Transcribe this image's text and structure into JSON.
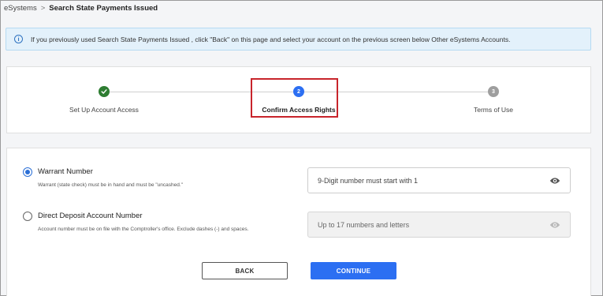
{
  "breadcrumb": {
    "root": "eSystems",
    "separator": ">",
    "current": "Search State Payments Issued"
  },
  "banner": {
    "icon": "info-icon",
    "text": "If you previously used Search State Payments Issued , click \"Back\" on this page and select your account on the previous screen below Other eSystems Accounts."
  },
  "steps": [
    {
      "number": "✓",
      "label": "Set Up Account Access",
      "state": "complete",
      "color": "#2e7d32"
    },
    {
      "number": "2",
      "label": "Confirm Access Rights",
      "state": "active",
      "color": "#2c6ff2"
    },
    {
      "number": "3",
      "label": "Terms of Use",
      "state": "pending",
      "color": "#9e9e9e"
    }
  ],
  "form": {
    "options": [
      {
        "title": "Warrant Number",
        "description": "Warrant (state check) must be in hand and must be \"uncashed.\"",
        "selected": true,
        "placeholder": "9-Digit number must start with 1",
        "disabled": false
      },
      {
        "title": "Direct Deposit Account Number",
        "description": "Account number must be on file with the Comptroller's office. Exclude dashes (-) and spaces.",
        "selected": false,
        "placeholder": "Up to 17 numbers and letters",
        "disabled": true
      }
    ],
    "back_label": "BACK",
    "continue_label": "CONTINUE"
  },
  "colors": {
    "accent": "#2c6ff2",
    "highlight": "#c8242b",
    "success": "#2e7d32"
  }
}
